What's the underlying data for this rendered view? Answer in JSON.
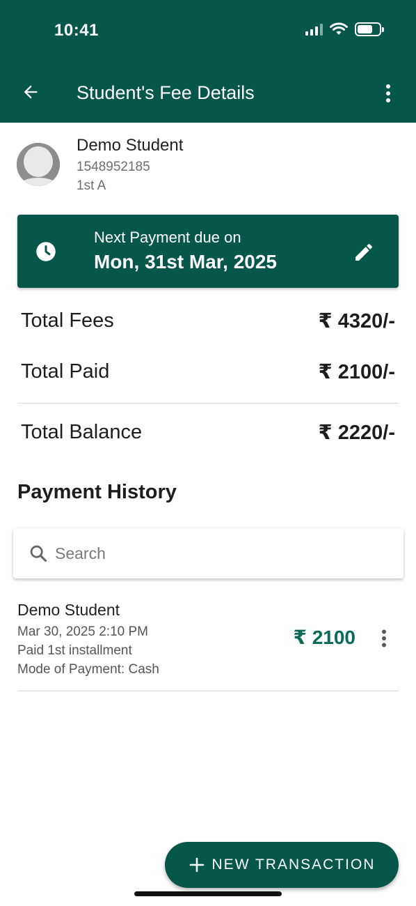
{
  "status_bar": {
    "time": "10:41"
  },
  "header": {
    "title": "Student's Fee Details"
  },
  "student": {
    "name": "Demo Student",
    "phone": "1548952185",
    "class": "1st A"
  },
  "due_card": {
    "label": "Next Payment due on",
    "date": "Mon, 31st Mar, 2025"
  },
  "summary": {
    "total_fees_label": "Total Fees",
    "total_fees_value": "₹ 4320/-",
    "total_paid_label": "Total Paid",
    "total_paid_value": "₹ 2100/-",
    "total_balance_label": "Total Balance",
    "total_balance_value": "₹ 2220/-"
  },
  "history": {
    "title": "Payment History",
    "search_placeholder": "Search",
    "transactions": [
      {
        "name": "Demo Student",
        "datetime": "Mar 30, 2025 2:10 PM",
        "note": "Paid 1st installment",
        "mode": "Mode of Payment: Cash",
        "amount": "₹ 2100"
      }
    ]
  },
  "fab": {
    "label": "NEW TRANSACTION"
  },
  "colors": {
    "primary": "#06574a",
    "amount": "#0a6a58",
    "divider": "#d8d8d8"
  }
}
